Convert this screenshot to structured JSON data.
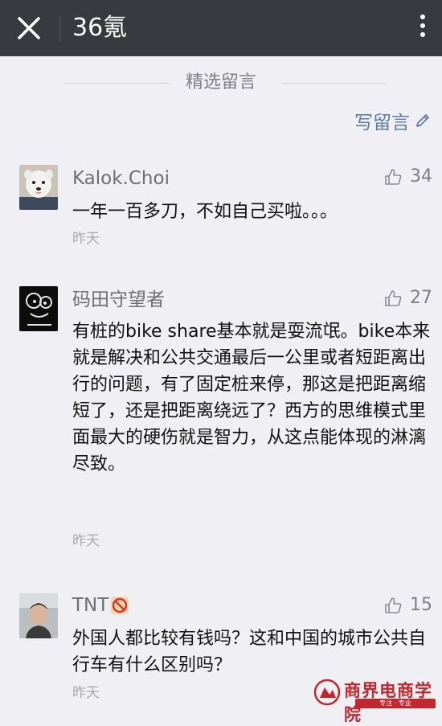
{
  "header": {
    "title": "36氪",
    "close_icon": "close-icon",
    "more_icon": "more-vertical-icon"
  },
  "section": {
    "title": "精选留言",
    "write_label": "写留言"
  },
  "comments": [
    {
      "nick": "Kalok.Choi",
      "likes": "34",
      "content": "一年一百多刀，不如自己买啦。。。",
      "time": "昨天"
    },
    {
      "nick": "码田守望者",
      "likes": "27",
      "content": "有桩的bike share基本就是耍流氓。bike本来就是解决和公共交通最后一公里或者短距离出行的问题，有了固定桩来停，那这是把距离缩短了，还是把距离绕远了？西方的思维模式里面最大的硬伤就是智力，从这点能体现的淋漓尽致。",
      "time": "昨天"
    },
    {
      "nick": "TNT",
      "nick_emoji": "no-entry-sign-icon",
      "likes": "15",
      "content": "外国人都比较有钱吗？这和中国的城市公共自行车有什么区别吗？",
      "time": "昨天"
    }
  ],
  "watermark": {
    "name": "商界电商学院",
    "sub": "专注 · 专业"
  },
  "colors": {
    "topbar": "#393a3f",
    "background": "#efeff4",
    "link": "#5f7da3",
    "watermark": "#c1272d"
  }
}
